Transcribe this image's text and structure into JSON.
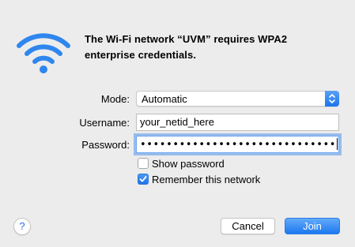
{
  "message": {
    "line1": "The Wi-Fi network “UVM” requires WPA2",
    "line2": "enterprise credentials."
  },
  "form": {
    "mode_label": "Mode:",
    "mode_value": "Automatic",
    "username_label": "Username:",
    "username_value": "your_netid_here",
    "password_label": "Password:",
    "password_mask": "••••••••••••••••••••••••••••••"
  },
  "options": {
    "show_password_label": "Show password",
    "show_password_checked": false,
    "remember_label": "Remember this network",
    "remember_checked": true
  },
  "buttons": {
    "help_label": "?",
    "cancel_label": "Cancel",
    "join_label": "Join"
  },
  "icons": {
    "wifi": "wifi-icon",
    "stepper": "chevron-up-down-icon",
    "check": "checkmark-icon"
  },
  "colors": {
    "accent": "#1c78f0",
    "wifi_blue": "#2f86ee",
    "background": "#ececec"
  }
}
